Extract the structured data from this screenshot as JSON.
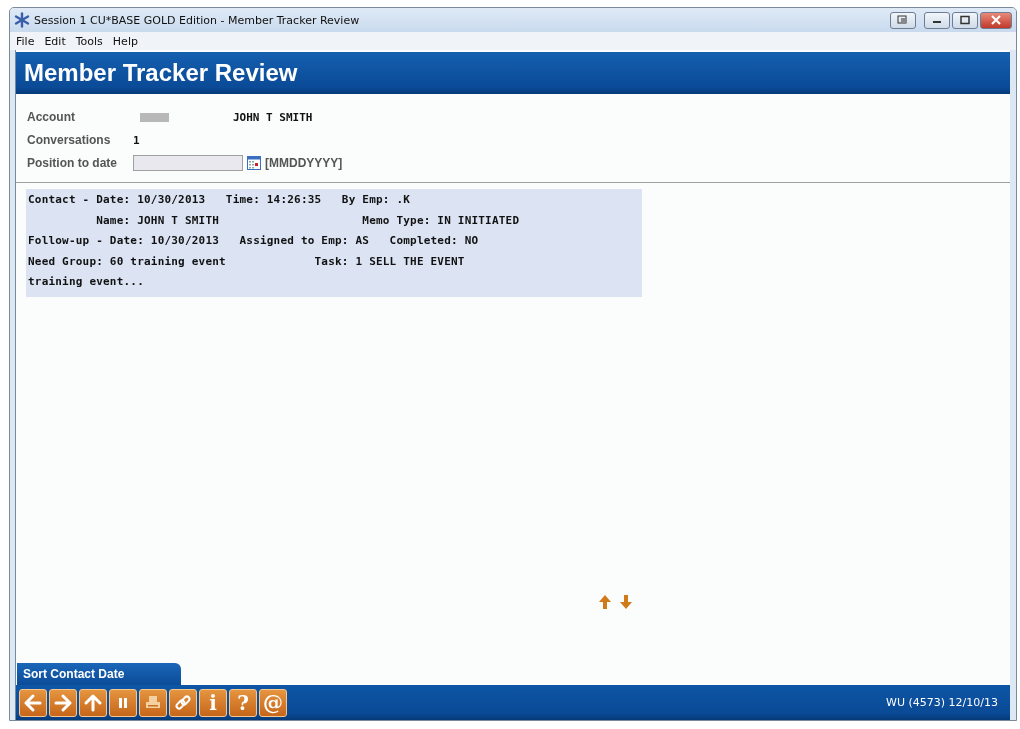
{
  "window": {
    "title": "Session 1 CU*BASE GOLD Edition - Member Tracker Review"
  },
  "menu": [
    "File",
    "Edit",
    "Tools",
    "Help"
  ],
  "header": {
    "title": "Member Tracker Review"
  },
  "fields": [
    {
      "kind": "masked",
      "label": "Account",
      "value": "JOHN T SMITH"
    },
    {
      "kind": "text",
      "label": "Conversations",
      "value": "1"
    },
    {
      "kind": "date",
      "label": "Position to date",
      "hint": "[MMDDYYYY]"
    }
  ],
  "memo": [
    "Contact - Date: 10/30/2013   Time: 14:26:35   By Emp: .K",
    "          Name: JOHN T SMITH                     Memo Type: IN INITIATED",
    "Follow-up - Date: 10/30/2013   Assigned to Emp: AS   Completed: NO",
    "Need Group: 60 training event             Task: 1 SELL THE EVENT",
    "training event..."
  ],
  "tab": {
    "label": "Sort Contact Date"
  },
  "toolbar": [
    {
      "kind": "back"
    },
    {
      "kind": "forward"
    },
    {
      "kind": "up"
    },
    {
      "kind": "pause"
    },
    {
      "kind": "print"
    },
    {
      "kind": "link"
    },
    {
      "kind": "text",
      "label": "i"
    },
    {
      "kind": "text",
      "label": "?"
    },
    {
      "kind": "text",
      "label": "@"
    }
  ],
  "status": "WU (4573) 12/10/13"
}
